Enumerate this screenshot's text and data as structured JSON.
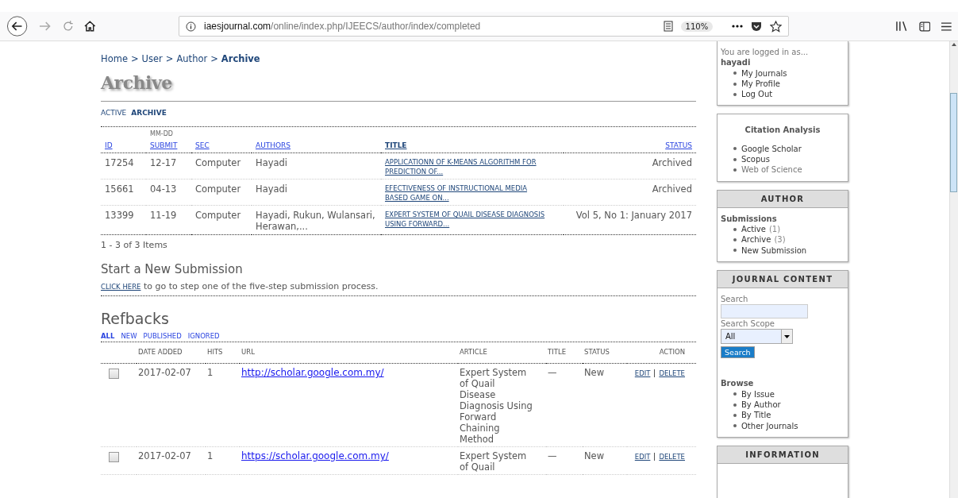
{
  "browser": {
    "url_host": "iaesjournal.com",
    "url_path": "/online/index.php/IJEECS/author/index/completed",
    "zoom": "110%"
  },
  "breadcrumb": [
    {
      "label": "Home",
      "current": false
    },
    {
      "label": "User",
      "current": false
    },
    {
      "label": "Author",
      "current": false
    },
    {
      "label": "Archive",
      "current": true
    }
  ],
  "breadcrumb_separator": ">",
  "page_title": "Archive",
  "tabs": [
    {
      "label": "ACTIVE",
      "selected": false
    },
    {
      "label": "ARCHIVE",
      "selected": true
    }
  ],
  "submissions": {
    "columns": [
      {
        "label": "ID"
      },
      {
        "label": "SUBMIT",
        "sublabel": "MM-DD"
      },
      {
        "label": "SEC"
      },
      {
        "label": "AUTHORS"
      },
      {
        "label": "TITLE"
      },
      {
        "label": "STATUS"
      }
    ],
    "rows": [
      {
        "id": "17254",
        "submit": "12-17",
        "sec": "Computer",
        "authors": "Hayadi",
        "title": "APPLICATIONN OF K-MEANS ALGORITHM FOR PREDICTION OF...",
        "status": "Archived"
      },
      {
        "id": "15661",
        "submit": "04-13",
        "sec": "Computer",
        "authors": "Hayadi",
        "title": "EFECTIVENESS OF INSTRUCTIONAL MEDIA BASED GAME ON...",
        "status": "Archived"
      },
      {
        "id": "13399",
        "submit": "11-19",
        "sec": "Computer",
        "authors": "Hayadi, Rukun, Wulansari, Herawan,...",
        "title": "EXPERT SYSTEM OF QUAIL DISEASE DIAGNOSIS USING FORWARD...",
        "status": "Vol 5, No 1: January 2017"
      }
    ],
    "count": "1 - 3 of 3 Items"
  },
  "new_submission": {
    "heading": "Start a New Submission",
    "link": "CLICK HERE",
    "text": "to go to step one of the five-step submission process."
  },
  "refbacks": {
    "heading": "Refbacks",
    "filters": [
      {
        "label": "ALL",
        "selected": true
      },
      {
        "label": "NEW",
        "selected": false
      },
      {
        "label": "PUBLISHED",
        "selected": false
      },
      {
        "label": "IGNORED",
        "selected": false
      }
    ],
    "columns": [
      "DATE ADDED",
      "HITS",
      "URL",
      "ARTICLE",
      "TITLE",
      "STATUS",
      "ACTION"
    ],
    "rows": [
      {
        "checked": false,
        "date": "2017-02-07",
        "hits": "1",
        "url": "http://scholar.google.com.my/",
        "article": "Expert System of Quail Disease Diagnosis Using Forward Chaining Method",
        "title": "—",
        "status": "New",
        "actions": [
          "EDIT",
          "DELETE"
        ]
      },
      {
        "checked": false,
        "date": "2017-02-07",
        "hits": "1",
        "url": "https://scholar.google.com.my/",
        "article": "Expert System of Quail",
        "title": "—",
        "status": "New",
        "actions": [
          "EDIT",
          "DELETE"
        ]
      }
    ]
  },
  "sidebar": {
    "user": {
      "logged_in_text": "You are logged in as...",
      "username": "hayadi",
      "links": [
        "My Journals",
        "My Profile",
        "Log Out"
      ]
    },
    "citation": {
      "title": "Citation Analysis",
      "links": [
        "Google Scholar",
        "Scopus",
        "Web of Science"
      ]
    },
    "author": {
      "title": "AUTHOR",
      "subtitle": "Submissions",
      "links": [
        {
          "label": "Active",
          "count": "(1)"
        },
        {
          "label": "Archive",
          "count": "(3)"
        },
        {
          "label": "New Submission"
        }
      ]
    },
    "journal_content": {
      "title": "JOURNAL CONTENT",
      "search_label": "Search",
      "scope_label": "Search Scope",
      "scope_value": "All",
      "search_button": "Search",
      "browse_title": "Browse",
      "browse_links": [
        "By Issue",
        "By Author",
        "By Title",
        "Other Journals"
      ]
    },
    "information": {
      "title": "INFORMATION"
    }
  }
}
